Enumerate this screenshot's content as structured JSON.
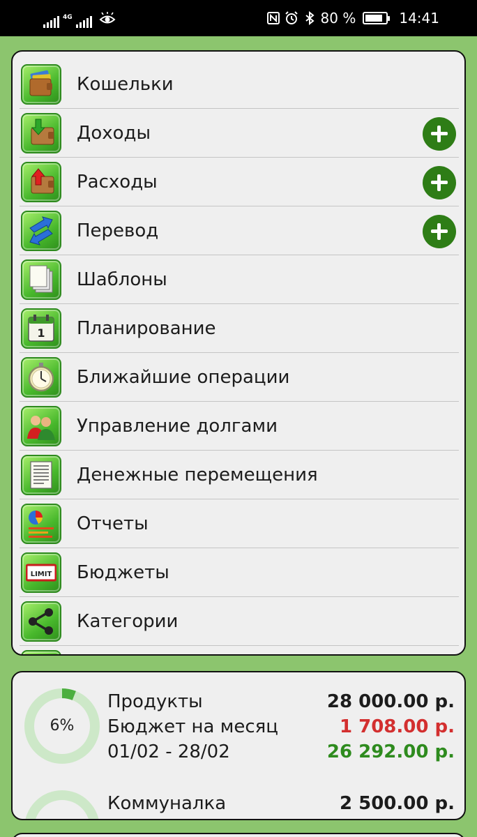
{
  "status_bar": {
    "network": "4G",
    "battery": "80 %",
    "time": "14:41"
  },
  "menu": {
    "items": [
      {
        "label": "Кошельки",
        "icon": "wallets-icon",
        "has_add": false
      },
      {
        "label": "Доходы",
        "icon": "income-icon",
        "has_add": true
      },
      {
        "label": "Расходы",
        "icon": "expense-icon",
        "has_add": true
      },
      {
        "label": "Перевод",
        "icon": "transfer-icon",
        "has_add": true
      },
      {
        "label": "Шаблоны",
        "icon": "templates-icon",
        "has_add": false
      },
      {
        "label": "Планирование",
        "icon": "calendar-icon",
        "has_add": false
      },
      {
        "label": "Ближайшие операции",
        "icon": "stopwatch-icon",
        "has_add": false
      },
      {
        "label": "Управление долгами",
        "icon": "people-icon",
        "has_add": false
      },
      {
        "label": "Денежные перемещения",
        "icon": "document-icon",
        "has_add": false
      },
      {
        "label": "Отчеты",
        "icon": "pie-chart-icon",
        "has_add": false
      },
      {
        "label": "Бюджеты",
        "icon": "limit-icon",
        "has_add": false
      },
      {
        "label": "Категории",
        "icon": "share-icon",
        "has_add": false
      }
    ],
    "limit_badge": "LIMIT",
    "calendar_day": "1"
  },
  "budgets": [
    {
      "percent": "6%",
      "percent_value": 0.06,
      "name": "Продукты",
      "amount": "28 000.00 р.",
      "period_label": "Бюджет на месяц",
      "spent": "1 708.00 р.",
      "date_range": "01/02 - 28/02",
      "remaining": "26 292.00 р."
    },
    {
      "name": "Коммуналка",
      "amount": "2 500.00 р."
    }
  ],
  "colors": {
    "background": "#8cc56e",
    "accent_green": "#2e7d16",
    "spent_red": "#d32f2f",
    "remaining_green": "#2e8b1e"
  }
}
